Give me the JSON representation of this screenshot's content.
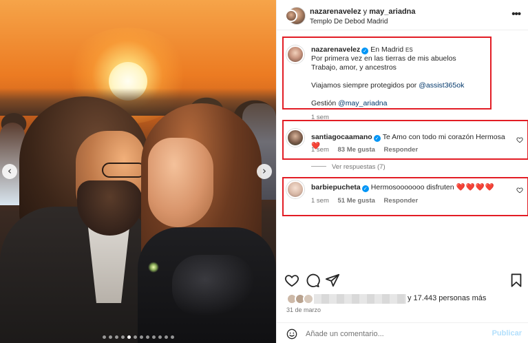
{
  "header": {
    "user_a": "nazarenavelez",
    "joiner": "y",
    "user_b": "may_ariadna",
    "location": "Templo De Debod Madrid",
    "more_icon": "more-horizontal-icon"
  },
  "caption": {
    "username": "nazarenavelez",
    "line1_after_name": "En Madrid",
    "flag_emoji": "ES",
    "line2": "Por primera vez en las tierras de mis abuelos",
    "line3": "Trabajo, amor, y ancestros",
    "line4_prefix": "Viajamos siempre protegidos por ",
    "line4_mention": "@assist365ok",
    "line5_prefix": "Gestión ",
    "line5_mention": "@may_ariadna",
    "time": "1 sem"
  },
  "comments": [
    {
      "username": "santiagocaamano",
      "text": "Te Amo con todo mi corazón Hermosa",
      "emoji": "❤️",
      "time": "1 sem",
      "likes": "83 Me gusta",
      "reply": "Responder"
    },
    {
      "username": "barbiepucheta",
      "text": "Hermosooooooo disfruten",
      "emoji": "❤️❤️❤️❤️",
      "time": "1 sem",
      "likes": "51 Me gusta",
      "reply": "Responder"
    }
  ],
  "view_replies": "Ver respuestas (7)",
  "likes": {
    "suffix": "y 17.443 personas más"
  },
  "date": "31 de marzo",
  "comment_box": {
    "placeholder": "Añade un comentario...",
    "post_label": "Publicar"
  },
  "carousel": {
    "slide_count": 12,
    "active_index": 4
  },
  "colors": {
    "highlight_box": "#e21c24",
    "verified_badge": "#0095f6",
    "link": "#00376b",
    "muted_text": "#737373",
    "post_disabled": "#b2dffc"
  }
}
